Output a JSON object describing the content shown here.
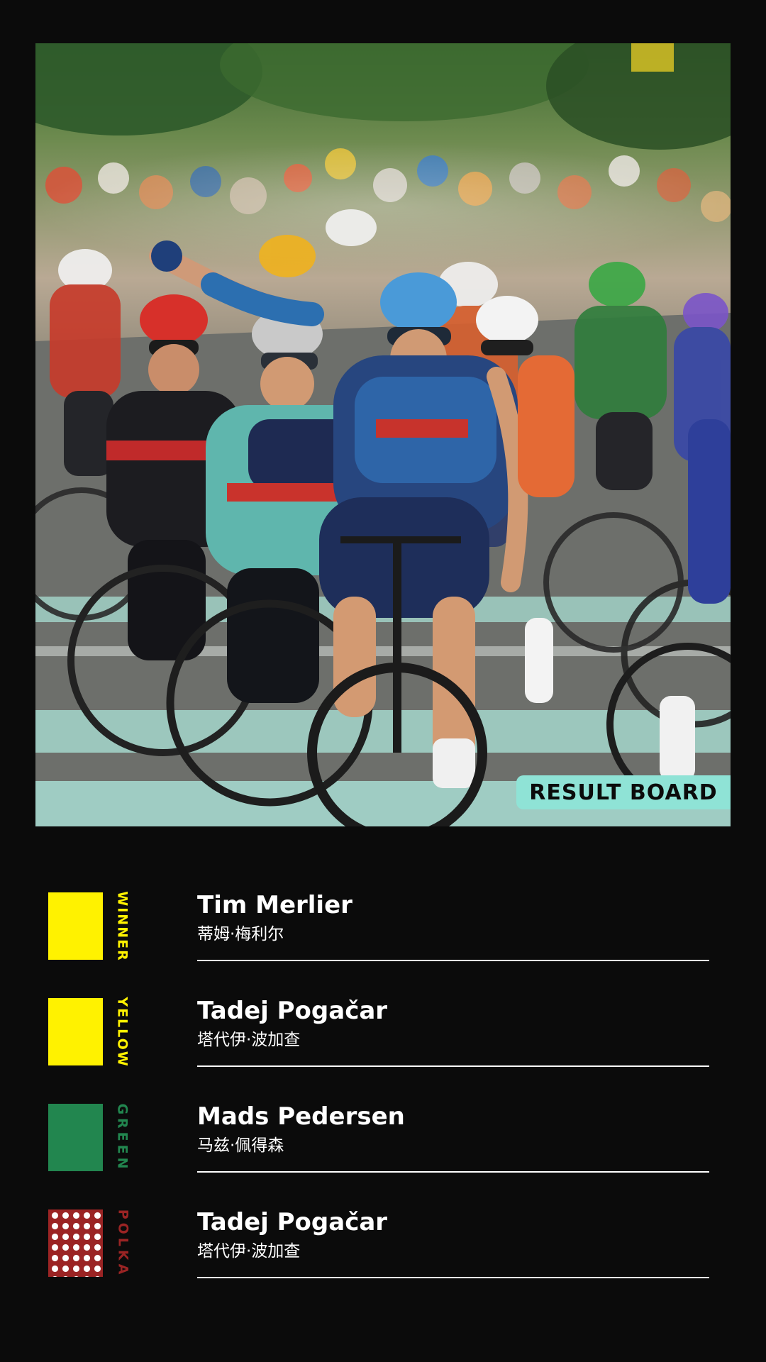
{
  "badge": {
    "label": "RESULT BOARD"
  },
  "results": [
    {
      "jersey": "WINNER",
      "name": "Tim Merlier",
      "name_cn": "蒂姆·梅利尔",
      "swatch_color": "#fff200",
      "label_color": "#fff200"
    },
    {
      "jersey": "YELLOW",
      "name": "Tadej Pogačar",
      "name_cn": "塔代伊·波加查",
      "swatch_color": "#fff200",
      "label_color": "#fff200"
    },
    {
      "jersey": "GREEN",
      "name": "Mads Pedersen",
      "name_cn": "马兹·佩得森",
      "swatch_color": "#22864f",
      "label_color": "#22864f"
    },
    {
      "jersey": "POLKA",
      "name": "Tadej Pogačar",
      "name_cn": "塔代伊·波加查",
      "swatch_color": "#9b2424",
      "label_color": "#9b2424"
    }
  ]
}
